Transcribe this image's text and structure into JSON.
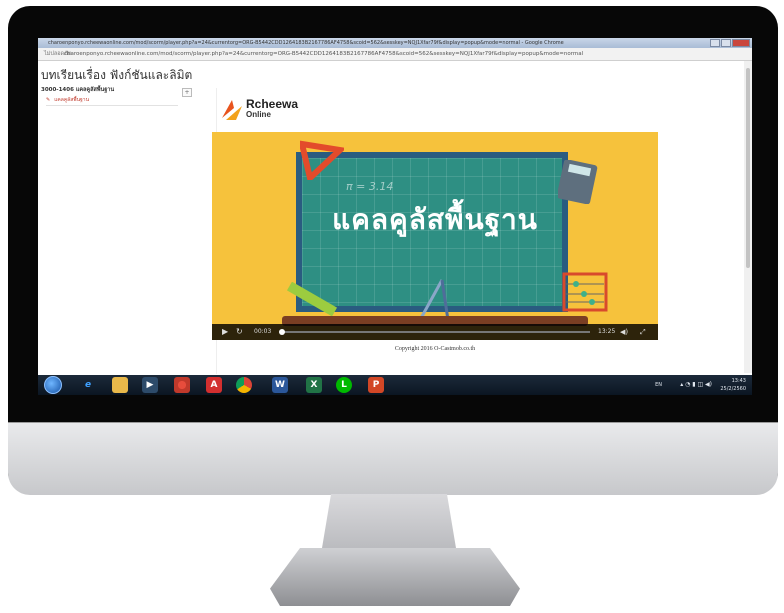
{
  "browser": {
    "window_title": "charoenponyo.rcheewaonline.com/mod/scorm/player.php?a=24&currentorg=ORG-B5442CDD1264183B2167786AF4758&scoid=562&sesskey=NQJ1Xfar79f&display=popup&mode=normal - Google Chrome",
    "info_label": "ไม่ปลอดภัย",
    "url": "charoenponyo.rcheewaonline.com/mod/scorm/player.php?a=24&currentorg=ORG-B5442CDD1264183B2167786AF4758&scoid=562&sesskey=NQJ1Xfar79f&display=popup&mode=normal"
  },
  "page": {
    "title": "บทเรียนเรื่อง ฟังก์ชันและลิมิต",
    "course_code": "3000-1406 แคลคูลัสพื้นฐาน",
    "add_button": "+",
    "lesson_item": "แคลคูลัสพื้นฐาน"
  },
  "logo": {
    "line1": "Rcheewa",
    "line2": "Online"
  },
  "video": {
    "headline": "แคลคูลัสพื้นฐาน",
    "pi_text": "π = 3.14",
    "current_time": "00:03",
    "duration": "13:25",
    "progress": 0.004
  },
  "copyright": "Copyright 2016 O-Castmob.co.th",
  "taskbar": {
    "apps": [
      "start",
      "internet-explorer",
      "file-explorer",
      "media-player",
      "chrome-alt",
      "acrobat",
      "chrome",
      "word",
      "excel",
      "line",
      "powerpoint"
    ],
    "language": "EN",
    "time": "13:43",
    "date": "25/2/2560"
  },
  "colors": {
    "video_bg": "#f6c23c",
    "board": "#2e8f83",
    "accent_red": "#c0392b"
  }
}
